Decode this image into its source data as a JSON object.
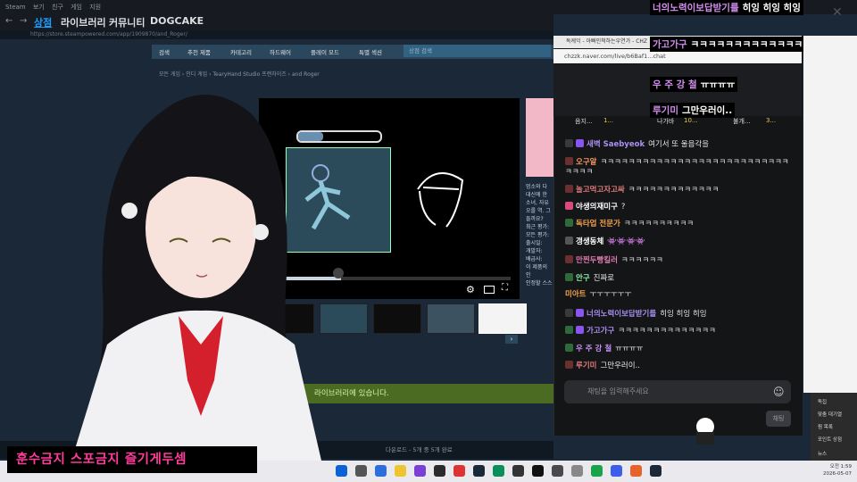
{
  "steam": {
    "title_menu": [
      "Steam",
      "보기",
      "친구",
      "게임",
      "지원"
    ],
    "nav_tabs": [
      "상점",
      "라이브러리",
      "커뮤니티",
      "DOGCAKE"
    ],
    "url": "https://store.steampowered.com/app/1909870/and_Roger/",
    "store_menu": [
      "검색",
      "추천 제품",
      "카테고리",
      "하드웨어",
      "플레이 모드",
      "특별 섹션"
    ],
    "search_placeholder": "상점 검색",
    "breadcrumb": "모든 게임 › 인디 게임 › TearyHand Studio 프랜차이즈 › and Roger",
    "desc_lines": [
      "멍소와 다",
      "대신에 한",
      "소녀, 자유",
      "오를 역. 그",
      "들까요?",
      "최근 평가:",
      "모든 평가:",
      "출시일:",
      "개발자:",
      "배급사:",
      "이 제품의 인",
      "인정할 스스"
    ],
    "library_banner": "라이브러리에 있습니다.",
    "downloads": "다운로드 - 5개 중 5개 완료"
  },
  "chat": {
    "browser_title": "독케익 - 아빠인척하는우연가 - CHZ",
    "browser_url": "chzzk.naver.com/live/b6Baf1...chat",
    "donors": [
      "음지...",
      "1...",
      "나가바",
      "10...",
      "불개...",
      "3..."
    ],
    "messages": [
      {
        "nick": "새벽 Saebyeok",
        "text": "여기서 또 울음각을",
        "nick_color": "#a98ff2",
        "badges": [
          "#3a3a3a",
          "#8a54f0"
        ]
      },
      {
        "nick": "오구알",
        "text": "ㅋㅋㅋㅋㅋㅋㅋㅋㅋㅋㅋㅋㅋㅋㅋㅋㅋㅋㅋㅋㅋㅋㅋㅋㅋㅋㅋㅋㅋㅋㅋ",
        "nick_color": "#ff9a60",
        "badges": [
          "#6a2f2f"
        ]
      },
      {
        "nick": "놀고먹고자고싸",
        "text": "ㅋㅋㅋㅋㅋㅋㅋㅋㅋㅋㅋㅋㅋ",
        "nick_color": "#e07a7a",
        "badges": [
          "#6a2f2f"
        ]
      },
      {
        "nick": "야생의재미구",
        "text": "?",
        "nick_color": "#ffffff",
        "badges": [
          "#d84b7a"
        ]
      },
      {
        "nick": "독타업 전문가",
        "text": "ㅋㅋㅋㅋㅋㅋㅋㅋㅋㅋ",
        "nick_color": "#f7a34d",
        "badges": [
          "#2f6a3a"
        ]
      },
      {
        "nick": "갱생동체",
        "text": "👾👾👾👾",
        "nick_color": "#ffffff",
        "badges": [
          "#555"
        ]
      },
      {
        "nick": "만찐두빵킬러",
        "text": "ㅋㅋㅋㅋㅋㅋ",
        "nick_color": "#e07ab0",
        "badges": [
          "#6a2f2f"
        ]
      },
      {
        "nick": "안구",
        "text": "진짜로",
        "nick_color": "#8ff0a8",
        "badges": [
          "#2f6a3a"
        ]
      },
      {
        "nick": "미아트",
        "text": "ㅜㅜㅜㅜㅜㅜ",
        "nick_color": "#f7a34d",
        "badges": []
      },
      {
        "nick": "너의노력이보답받기를",
        "text": "히잉 히잉 히잉",
        "nick_color": "#a98ff2",
        "badges": [
          "#3a3a3a",
          "#8a54f0"
        ]
      },
      {
        "nick": "가고가구",
        "text": "ㅋㅋㅋㅋㅋㅋㅋㅋㅋㅋㅋㅋㅋㅋ",
        "nick_color": "#a98ff2",
        "badges": [
          "#2f6a3a",
          "#8a54f0"
        ]
      },
      {
        "nick": "우 주 강 철",
        "text": "ㅠㅠㅠㅠ",
        "nick_color": "#c48ff2",
        "badges": [
          "#2f6a3a"
        ]
      },
      {
        "nick": "루기미",
        "text": "그만우러이..",
        "nick_color": "#e07a7a",
        "badges": [
          "#6a2f2f"
        ]
      }
    ],
    "input_placeholder": "채팅을 입력해주세요",
    "send_label": "채팅"
  },
  "overlay_chat": [
    {
      "nick": "너의노력이보답받기를",
      "text": "히잉 히잉 히잉"
    },
    {
      "nick": "가고가구",
      "text": "ㅋㅋㅋㅋㅋㅋㅋㅋㅋㅋㅋㅋㅋㅋ"
    },
    {
      "nick": "우 주 강 철",
      "text": "ㅠㅠㅠㅠ"
    },
    {
      "nick": "루기미",
      "text": "그만우러이.."
    }
  ],
  "side_menu": [
    "독집",
    "맞춤 대기열",
    "찜 목록",
    "포인트 상점",
    "뉴스"
  ],
  "banner": "훈수금지 스포금지 즐기게두셈",
  "clock": {
    "time": "오전 1:59",
    "date": "2026-05-07"
  },
  "colors": {
    "steam_bg": "#1b2838",
    "chat_bg": "#141517",
    "banner_text": "#ff3c9a",
    "library_green": "#4c6b22"
  }
}
